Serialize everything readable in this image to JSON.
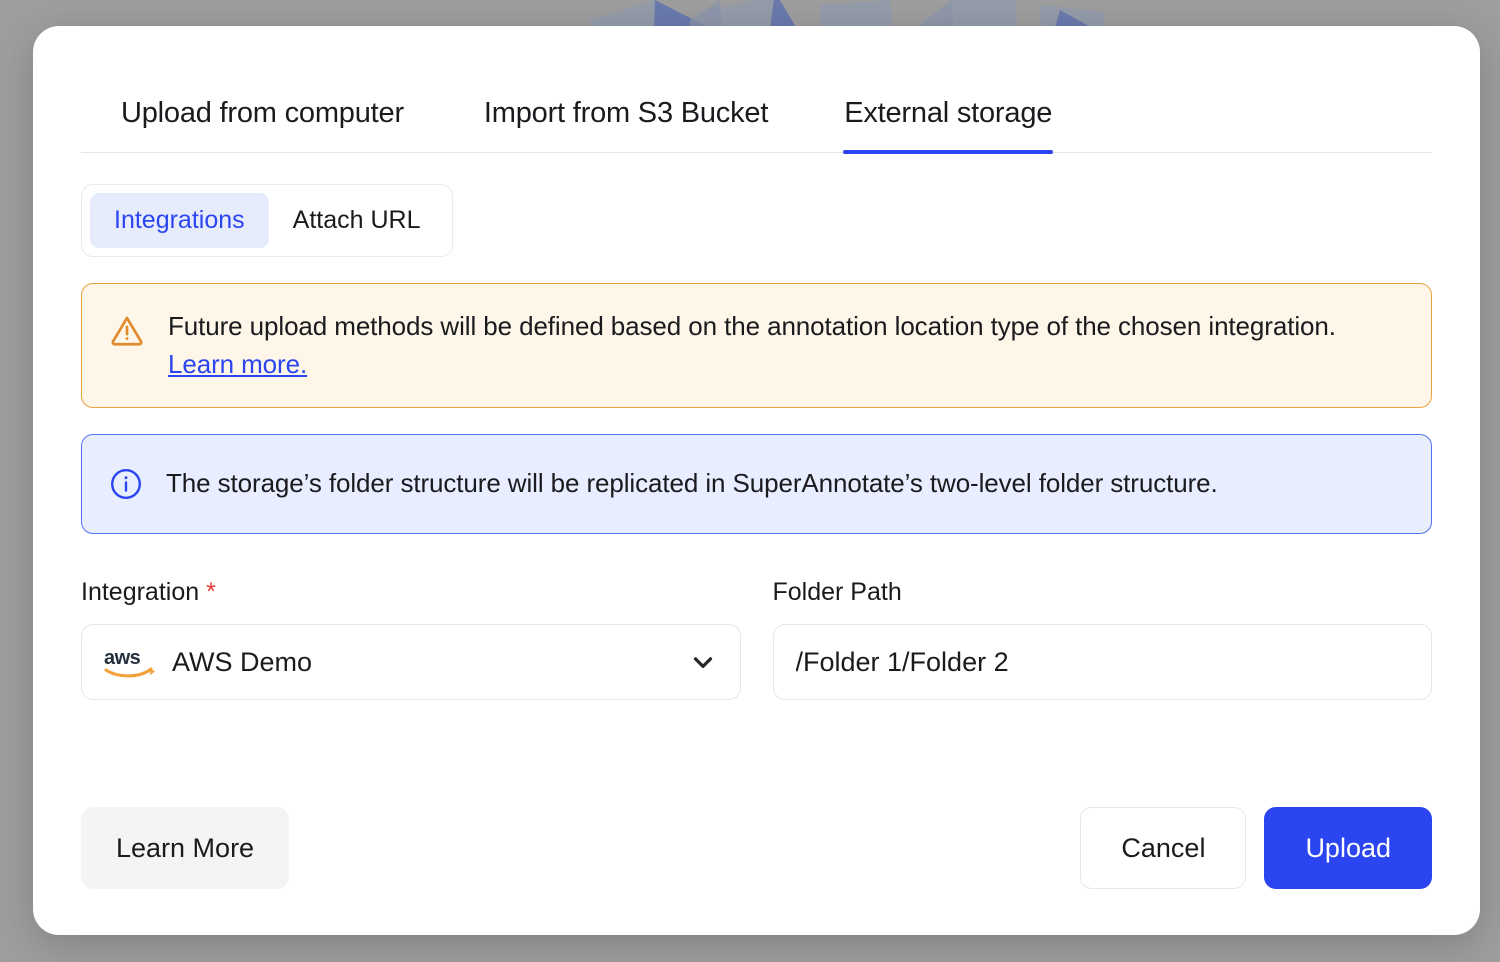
{
  "modal": {
    "tabs": [
      {
        "label": "Upload from computer",
        "active": false
      },
      {
        "label": "Import from S3 Bucket",
        "active": false
      },
      {
        "label": "External storage",
        "active": true
      }
    ],
    "segmented": [
      {
        "label": "Integrations",
        "active": true
      },
      {
        "label": "Attach URL",
        "active": false
      }
    ],
    "warning_banner": {
      "icon": "warning-triangle-icon",
      "text": "Future upload methods will be defined based on the annotation location type of the chosen integration. ",
      "link_label": "Learn more.",
      "border_color": "#e9a33c",
      "background_color": "#fdf6e9",
      "icon_color": "#e08c2e"
    },
    "info_banner": {
      "icon": "info-circle-icon",
      "text": "The storage’s folder structure will be replicated in SuperAnnotate’s two-level folder structure.",
      "border_color": "#5570f2",
      "background_color": "#e8eeff",
      "icon_color": "#2b46f0"
    },
    "fields": {
      "integration": {
        "label": "Integration",
        "required_marker": "*",
        "icon": "aws-logo-icon",
        "value": "AWS Demo",
        "dropdown_icon": "chevron-down-icon"
      },
      "folder_path": {
        "label": "Folder Path",
        "value": "/Folder 1/Folder 2",
        "placeholder": "/Folder 1/Folder 2"
      }
    },
    "footer": {
      "learn_more_label": "Learn More",
      "cancel_label": "Cancel",
      "upload_label": "Upload"
    },
    "colors": {
      "accent_blue": "#2b46f0",
      "segment_active_bg": "#e7ecfd",
      "required_red": "#e0382d",
      "overlay_gray": "#ababab"
    }
  }
}
